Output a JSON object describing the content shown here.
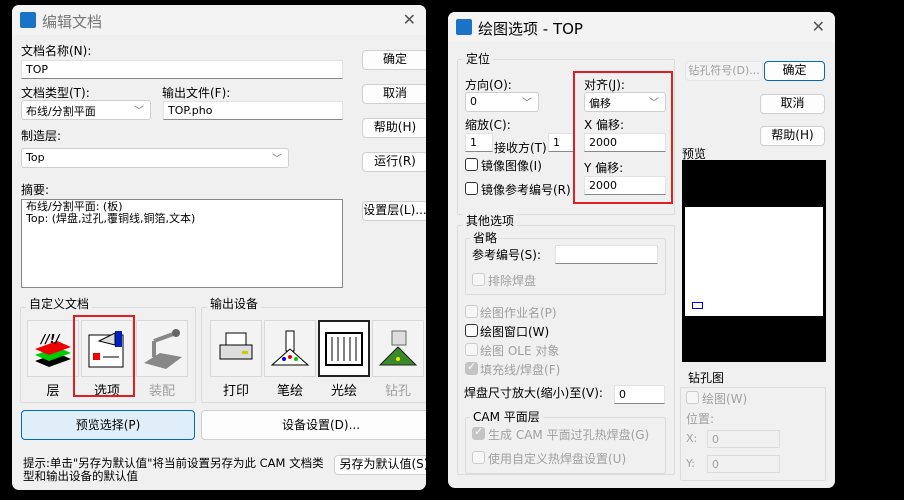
{
  "left": {
    "title": "编辑文档",
    "doc_name_label": "文档名称(N):",
    "doc_name_value": "TOP",
    "doc_type_label": "文档类型(T):",
    "doc_type_value": "布线/分割平面",
    "output_file_label": "输出文件(F):",
    "output_file_value": "TOP.pho",
    "layer_label": "制造层:",
    "layer_value": "Top",
    "summary_label": "摘要:",
    "summary_lines": [
      "布线/分割平面: (板)",
      "Top: (焊盘,过孔,覆铜线,铜箔,文本)"
    ],
    "buttons": {
      "ok": "确定",
      "cancel": "取消",
      "help": "帮助(H)",
      "run": "运行(R)",
      "layers": "设置层(L)..."
    },
    "custom_group": "自定义文档",
    "custom_items": [
      {
        "label": "层",
        "icon": "layers-icon"
      },
      {
        "label": "选项",
        "icon": "options-icon"
      },
      {
        "label": "装配",
        "icon": "assembly-icon",
        "disabled": true
      }
    ],
    "device_group": "输出设备",
    "device_items": [
      {
        "label": "打印",
        "icon": "printer-icon"
      },
      {
        "label": "笔绘",
        "icon": "pen-plotter-icon"
      },
      {
        "label": "光绘",
        "icon": "photoplot-icon",
        "selected": true
      },
      {
        "label": "钻孔",
        "icon": "drill-icon",
        "disabled": true
      }
    ],
    "preview_select": "预览选择(P)",
    "device_setup": "设备设置(D)...",
    "hint": "提示:单击\"另存为默认值\"将当前设置另存为此 CAM 文档类型和输出设备的默认值",
    "save_default": "另存为默认值(S)"
  },
  "right": {
    "title": "绘图选项 - TOP",
    "position_group": "定位",
    "orientation_label": "方向(O):",
    "orientation_value": "0",
    "scale_label": "缩放(C):",
    "scale_value": "1",
    "receiver_label": "接收方(T)",
    "receiver_value": "1",
    "mirror_image": "镜像图像(I)",
    "mirror_refdes": "镜像参考编号(R)",
    "justify_label": "对齐(J):",
    "justify_value": "偏移",
    "x_offset_label": "X 偏移:",
    "x_offset_value": "2000",
    "y_offset_label": "Y 偏移:",
    "y_offset_value": "2000",
    "drill_symbol": "钻孔符号(D)...",
    "ok": "确定",
    "cancel": "取消",
    "help": "帮助(H)",
    "preview_label": "预览",
    "other_group": "其他选项",
    "omit_group": "省略",
    "refdes_label": "参考编号(S):",
    "refdes_value": "",
    "exclude_pads": "排除焊盘",
    "plot_job_name": "绘图作业名(P)",
    "plot_window": "绘图窗口(W)",
    "plot_ole": "绘图 OLE 对象",
    "fill_lines": "填充线/焊盘(F)",
    "pad_scale_label": "焊盘尺寸放大(缩小)至(V):",
    "pad_scale_value": "0",
    "cam_group": "CAM 平面层",
    "cam_thermal": "生成 CAM 平面过孔热焊盘(G)",
    "custom_thermal": "使用自定义热焊盘设置(U)",
    "drill_group": "钻孔图",
    "drill_plot": "绘图(W)",
    "location_label": "位置:",
    "x_label": "X:",
    "x_value": "0",
    "y_label": "Y:",
    "y_value": "0"
  },
  "colors": {
    "highlight": "#e02020",
    "accent": "#0067c0"
  }
}
